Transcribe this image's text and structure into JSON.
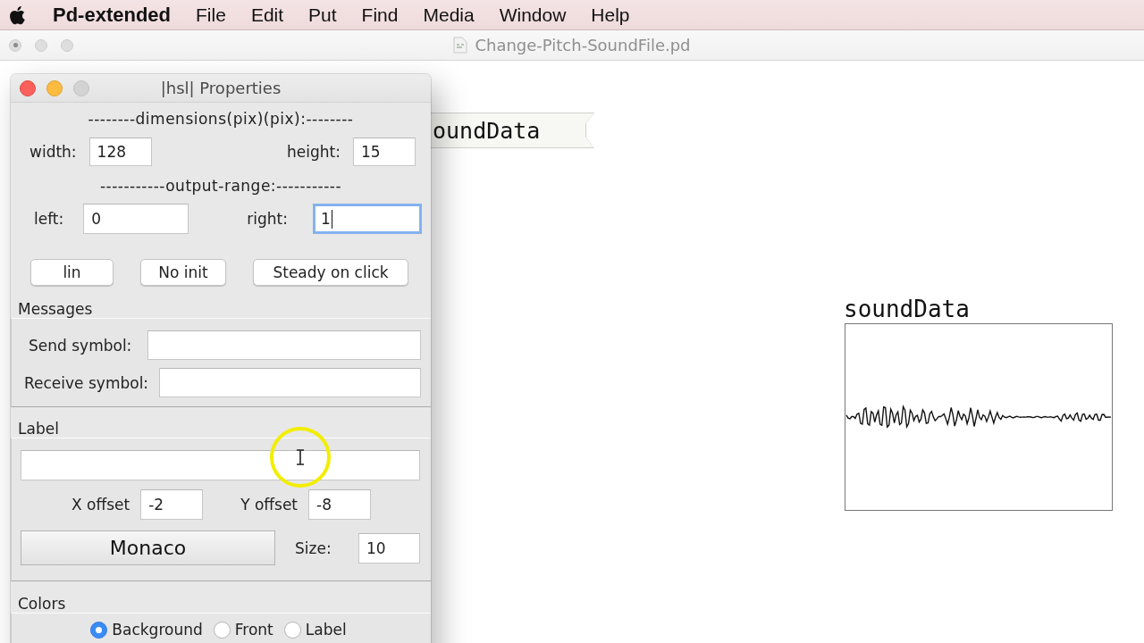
{
  "menu_bar": {
    "app_name": "Pd-extended",
    "items": [
      "File",
      "Edit",
      "Put",
      "Find",
      "Media",
      "Window",
      "Help"
    ]
  },
  "patch_window": {
    "title": "Change-Pitch-SoundFile.pd",
    "message_box": "oundData",
    "array_name": "soundData"
  },
  "dialog": {
    "title": "|hsl| Properties",
    "dimensions": {
      "heading": "--------dimensions(pix)(pix):--------",
      "fields": [
        {
          "label": "width:",
          "value": "128",
          "focused": false
        },
        {
          "label": "height:",
          "value": "15",
          "focused": false
        }
      ]
    },
    "output_range": {
      "heading": "-----------output-range:-----------",
      "fields": [
        {
          "label": "left:",
          "value": "0",
          "focused": false
        },
        {
          "label": "right:",
          "value": "1",
          "focused": true
        }
      ]
    },
    "buttons": [
      "lin",
      "No init",
      "Steady on click"
    ],
    "messages": {
      "heading": "Messages",
      "fields": [
        {
          "label": "Send symbol:",
          "focused": false
        },
        {
          "label": "Receive symbol:",
          "focused": false
        }
      ]
    },
    "label": {
      "heading": "Label",
      "text_field": {
        "focused": false
      },
      "offsets": [
        {
          "label": "X offset",
          "value": "-2",
          "focused": false
        },
        {
          "label": "Y offset",
          "value": "-8",
          "focused": false
        }
      ],
      "font_button": "Monaco",
      "size": {
        "label": "Size:",
        "value": "10",
        "focused": false
      }
    },
    "colors": {
      "heading": "Colors",
      "options": [
        {
          "label": "Background",
          "selected": true
        },
        {
          "label": "Front",
          "selected": false
        },
        {
          "label": "Label",
          "selected": false
        }
      ]
    }
  }
}
